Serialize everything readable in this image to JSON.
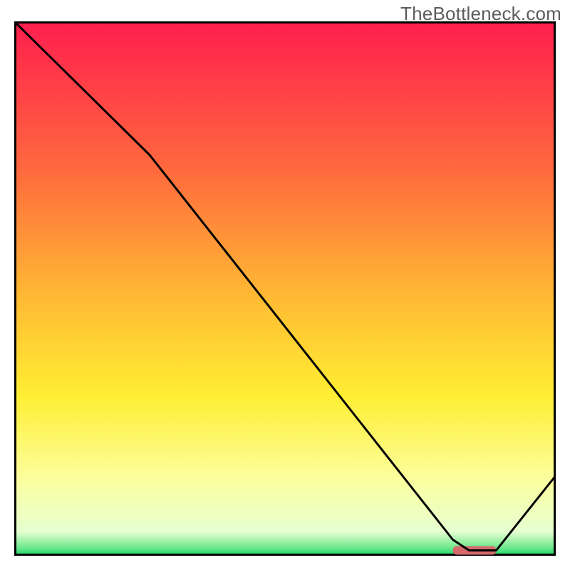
{
  "watermark": "TheBottleneck.com",
  "chart_data": {
    "type": "line",
    "title": "",
    "xlabel": "",
    "ylabel": "",
    "xlim": [
      0,
      100
    ],
    "ylim": [
      0,
      100
    ],
    "grid": false,
    "legend": false,
    "axes_visible": false,
    "series": [
      {
        "name": "curve",
        "x": [
          0,
          25,
          81,
          84,
          89,
          100
        ],
        "values": [
          100,
          75,
          3,
          1,
          1,
          15
        ]
      }
    ],
    "marker": {
      "x_start": 81,
      "x_end": 89,
      "y": 1,
      "color": "#d46a6a"
    },
    "background_gradient": {
      "stops": [
        {
          "pos": 0.0,
          "color": "#ff1e4e"
        },
        {
          "pos": 0.28,
          "color": "#ff6a3d"
        },
        {
          "pos": 0.52,
          "color": "#ffbb33"
        },
        {
          "pos": 0.7,
          "color": "#ffee33"
        },
        {
          "pos": 0.86,
          "color": "#fbffa0"
        },
        {
          "pos": 0.955,
          "color": "#e6ffd1"
        },
        {
          "pos": 0.985,
          "color": "#6de88c"
        },
        {
          "pos": 1.0,
          "color": "#18d46a"
        }
      ]
    },
    "border_color": "#000000",
    "line_color": "#000000"
  }
}
